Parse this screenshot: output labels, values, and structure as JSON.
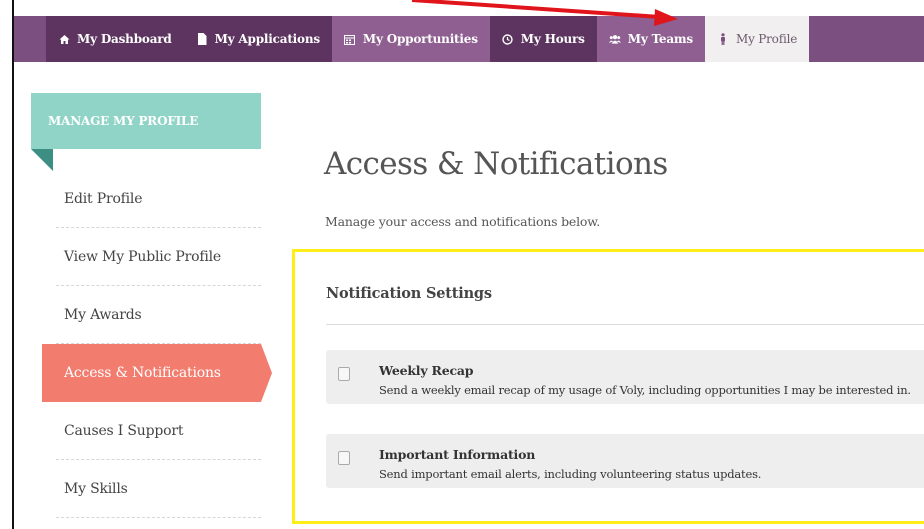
{
  "nav": {
    "items": [
      {
        "label": "My Dashboard",
        "icon": "home-icon"
      },
      {
        "label": "My Applications",
        "icon": "document-icon"
      },
      {
        "label": "My Opportunities",
        "icon": "calendar-icon"
      },
      {
        "label": "My Hours",
        "icon": "clock-icon"
      },
      {
        "label": "My Teams",
        "icon": "team-icon"
      },
      {
        "label": "My Profile",
        "icon": "person-icon",
        "active": true
      }
    ]
  },
  "sidebar": {
    "heading": "MANAGE MY PROFILE",
    "items": [
      {
        "label": "Edit Profile"
      },
      {
        "label": "View My Public Profile"
      },
      {
        "label": "My Awards"
      },
      {
        "label": "Access & Notifications",
        "active": true
      },
      {
        "label": "Causes I Support"
      },
      {
        "label": "My Skills"
      }
    ]
  },
  "main": {
    "title": "Access & Notifications",
    "subtitle": "Manage your access and notifications below.",
    "panel": {
      "title": "Notification Settings",
      "settings": [
        {
          "title": "Weekly Recap",
          "description": "Send a weekly email recap of my usage of Voly, including opportunities I may be interested in.",
          "checked": false
        },
        {
          "title": "Important Information",
          "description": "Send important email alerts, including volunteering status updates.",
          "checked": false
        }
      ]
    }
  },
  "colors": {
    "nav_bg": "#7b4f7f",
    "sidebar_heading": "#8fd4c6",
    "active_item": "#f27c6e",
    "highlight_border": "#ffef19",
    "annotation_arrow": "#e0141b"
  }
}
